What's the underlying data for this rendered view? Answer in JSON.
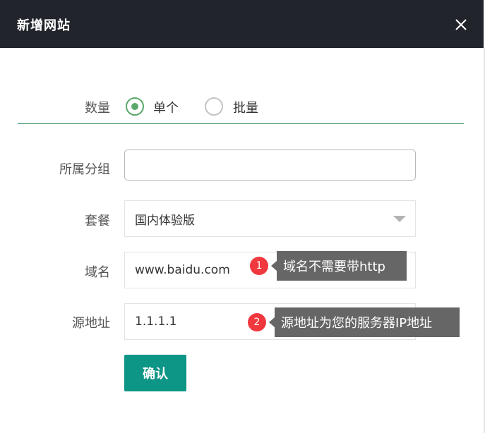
{
  "dialog": {
    "title": "新增网站",
    "close_icon": "close-icon"
  },
  "form": {
    "quantity": {
      "label": "数量",
      "options": [
        {
          "label": "单个",
          "selected": true
        },
        {
          "label": "批量",
          "selected": false
        }
      ]
    },
    "group": {
      "label": "所属分组",
      "value": ""
    },
    "package": {
      "label": "套餐",
      "value": "国内体验版",
      "dropdown_icon": "caret-down-icon"
    },
    "domain": {
      "label": "域名",
      "value": "www.baidu.com"
    },
    "source": {
      "label": "源地址",
      "value": "1.1.1.1"
    },
    "confirm_label": "确认"
  },
  "tips": [
    {
      "number": "1",
      "text": "域名不需要带http"
    },
    {
      "number": "2",
      "text": "源地址为您的服务器IP地址"
    }
  ],
  "colors": {
    "header_bg": "#21252b",
    "accent_green": "#5aa86a",
    "confirm_bg": "#0d9585",
    "tip_bg": "#666666",
    "tip_badge": "#f0383e"
  }
}
